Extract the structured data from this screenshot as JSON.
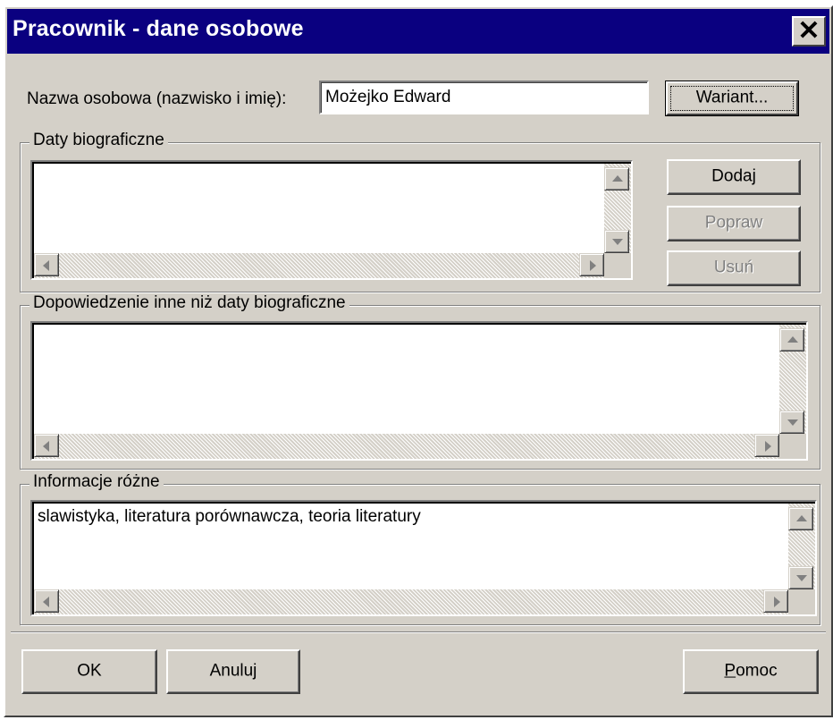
{
  "window": {
    "title": "Pracownik - dane osobowe",
    "close_symbol": "✕"
  },
  "name_row": {
    "label": "Nazwa osobowa (nazwisko i imię):",
    "value": "Możejko Edward",
    "wariant_button": "Wariant..."
  },
  "daty_group": {
    "title": "Daty biograficzne",
    "items": [],
    "buttons": {
      "dodaj": "Dodaj",
      "popraw": "Popraw",
      "usun": "Usuń"
    }
  },
  "dopowiedzenie_group": {
    "title": "Dopowiedzenie inne niż daty biograficzne",
    "items": []
  },
  "informacje_group": {
    "title": "Informacje różne",
    "items": [
      "slawistyka, literatura porównawcza, teoria literatury"
    ]
  },
  "footer": {
    "ok": "OK",
    "anuluj": "Anuluj",
    "pomoc_first": "P",
    "pomoc_rest": "omoc"
  },
  "colors": {
    "title_bar": "#0a0080",
    "face": "#d4d0c8",
    "disabled_text": "#808080"
  }
}
